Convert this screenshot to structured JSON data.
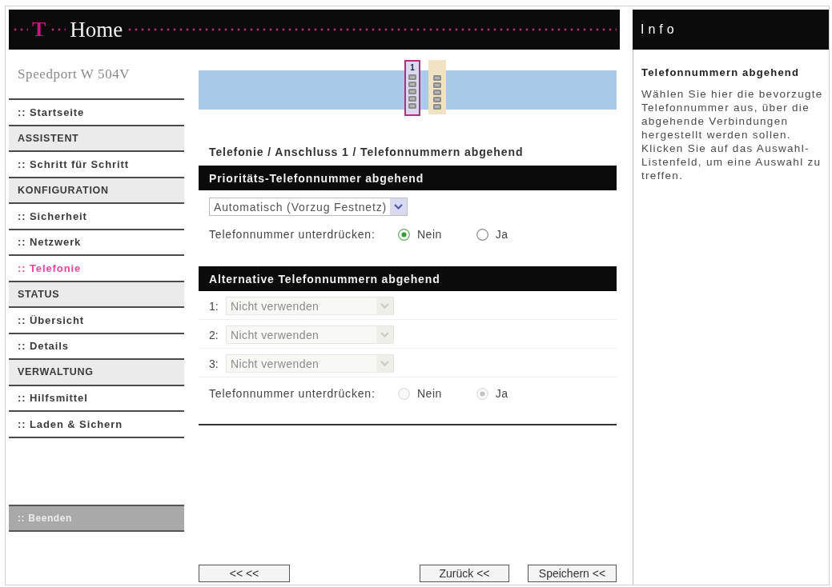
{
  "header": {
    "logo": "T",
    "title": "Home"
  },
  "sidebar": {
    "product": "Speedport W 504V",
    "items": [
      {
        "kind": "link",
        "label": ":: Startseite",
        "selected": false
      },
      {
        "kind": "section",
        "label": "ASSISTENT"
      },
      {
        "kind": "link",
        "label": ":: Schritt für Schritt",
        "selected": false
      },
      {
        "kind": "section",
        "label": "KONFIGURATION"
      },
      {
        "kind": "link",
        "label": ":: Sicherheit",
        "selected": false
      },
      {
        "kind": "link",
        "label": ":: Netzwerk",
        "selected": false
      },
      {
        "kind": "link",
        "label": ":: Telefonie",
        "selected": true
      },
      {
        "kind": "section",
        "label": "STATUS"
      },
      {
        "kind": "link",
        "label": ":: Übersicht",
        "selected": false
      },
      {
        "kind": "link",
        "label": ":: Details",
        "selected": false
      },
      {
        "kind": "section",
        "label": "VERWALTUNG"
      },
      {
        "kind": "link",
        "label": ":: Hilfsmittel",
        "selected": false
      },
      {
        "kind": "link",
        "label": ":: Laden & Sichern",
        "selected": false
      }
    ],
    "exit": {
      "label": ":: Beenden"
    }
  },
  "ports": [
    {
      "label": "1",
      "selected": true
    },
    {
      "selected": false
    }
  ],
  "breadcrumb": "Telefonie / Anschluss 1 / Telefonnummern abgehend",
  "priority": {
    "title": "Prioritäts-Telefonnummer abgehend",
    "select": {
      "value": "Automatisch (Vorzug Festnetz)",
      "disabled": false
    },
    "suppress": {
      "label": "Telefonnummer unterdrücken:",
      "options": [
        {
          "label": "Nein",
          "checked": true,
          "disabled": false
        },
        {
          "label": "Ja",
          "checked": false,
          "disabled": false
        }
      ]
    }
  },
  "alternatives": {
    "title": "Alternative Telefonnummern abgehend",
    "rows": [
      {
        "number": "1:",
        "value": "Nicht verwenden",
        "disabled": true
      },
      {
        "number": "2:",
        "value": "Nicht verwenden",
        "disabled": true
      },
      {
        "number": "3:",
        "value": "Nicht verwenden",
        "disabled": true
      }
    ],
    "suppress": {
      "label": "Telefonnummer unterdrücken:",
      "options": [
        {
          "label": "Nein",
          "checked": false,
          "disabled": true
        },
        {
          "label": "Ja",
          "checked": true,
          "disabled": true
        }
      ]
    }
  },
  "buttons": [
    {
      "kind": "nav",
      "label": "<< <<"
    },
    {
      "kind": "back",
      "label": "Zurück <<"
    },
    {
      "kind": "save",
      "label": "Speichern <<"
    }
  ],
  "info": {
    "title": "Info",
    "heading": "Telefonnummern abgehend",
    "text": "Wählen Sie hier die bevorzugte Telefonnummer aus, über die abgehende Verbindungen hergestellt werden sollen. Klicken Sie auf das Auswahl-Listenfeld, um eine Auswahl zu treffen."
  }
}
